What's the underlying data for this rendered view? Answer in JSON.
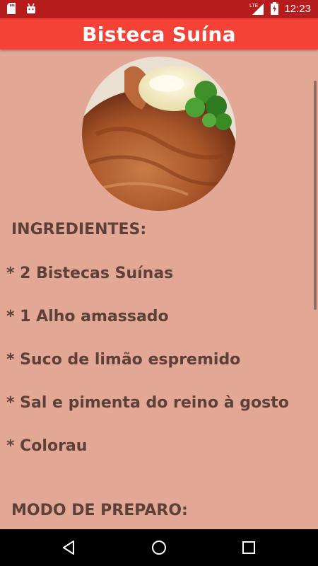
{
  "status_bar": {
    "time": "12:23",
    "network": "LTE",
    "icons": [
      "sd-card-icon",
      "android-icon",
      "lte-signal-icon",
      "battery-charging-icon"
    ]
  },
  "app_bar": {
    "title": "Bisteca Suína"
  },
  "recipe": {
    "photo_description_icon": "pork-chop-photo",
    "ingredients_heading": "INGREDIENTES:",
    "ingredients": [
      "* 2 Bistecas Suínas",
      "* 1 Alho amassado",
      "* Suco de limão espremido",
      "* Sal e pimenta do reino à gosto",
      "* Colorau"
    ],
    "method_heading": "MODO DE PREPARO:"
  },
  "nav_bar": {
    "buttons": [
      "back-icon",
      "home-icon",
      "recents-icon"
    ]
  },
  "colors": {
    "status_bar": "#b71c1c",
    "app_bar": "#f44336",
    "background": "#e2a895",
    "text": "#5d4037"
  }
}
